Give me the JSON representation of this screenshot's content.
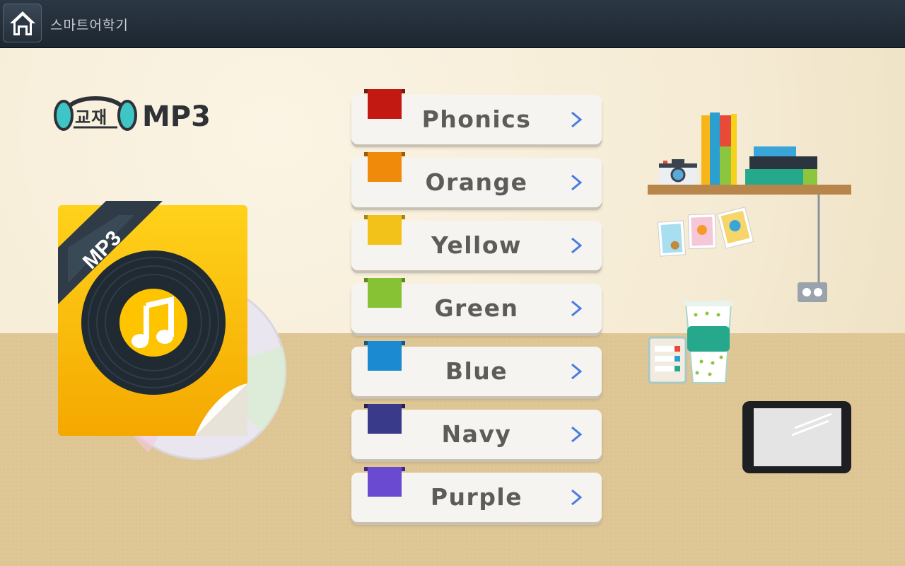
{
  "window": {
    "title": "스마트어학기"
  },
  "header": {
    "logo_kor": "교재",
    "logo_text": "MP3"
  },
  "album": {
    "ribbon_text": "MP3"
  },
  "menu": {
    "items": [
      {
        "label": "Phonics",
        "color": "#c21a12"
      },
      {
        "label": "Orange",
        "color": "#f08a0a"
      },
      {
        "label": "Yellow",
        "color": "#f2c21a"
      },
      {
        "label": "Green",
        "color": "#86c234"
      },
      {
        "label": "Blue",
        "color": "#1c8ad0"
      },
      {
        "label": "Navy",
        "color": "#3a3a8a"
      },
      {
        "label": "Purple",
        "color": "#6a4ad0"
      }
    ]
  },
  "colors": {
    "chevron": "#4a7be0",
    "topbar": "#232e39",
    "floor": "#dec594",
    "wall": "#f7efdc"
  }
}
